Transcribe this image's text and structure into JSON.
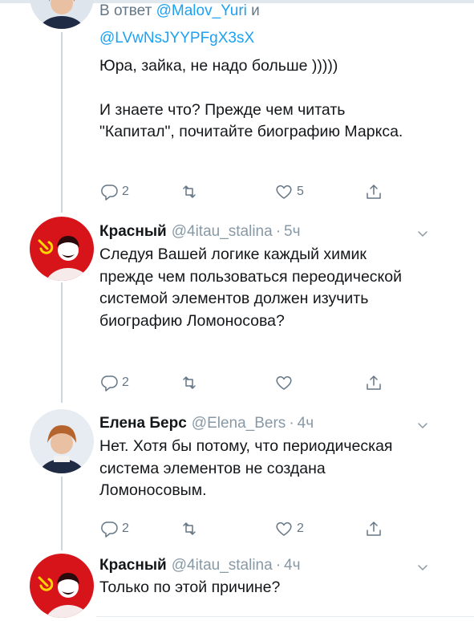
{
  "tweets": [
    {
      "reply_prefix": "В ответ",
      "reply_mention_1": "@Malov_Yuri",
      "reply_conjunction": "и",
      "reply_mention_2": "@LVwNsJYYPFgX3sX",
      "paragraph_1": "Юра, зайка, не надо больше )))))",
      "paragraph_2": "И знаете что? Прежде чем читать \"Капитал\", почитайте биографию Маркса.",
      "reply_count": "2",
      "retweet_count": "",
      "like_count": "5"
    },
    {
      "name": "Красный",
      "handle": "@4itau_stalina",
      "separator": "·",
      "time": "5ч",
      "text": "Следуя Вашей логике каждый химик прежде чем пользоваться переодической системой элементов должен изучить биографию Ломоносова?",
      "reply_count": "2",
      "retweet_count": "",
      "like_count": ""
    },
    {
      "name": "Елена Берс",
      "handle": "@Elena_Bers",
      "separator": "·",
      "time": "4ч",
      "text": "Нет. Хотя бы потому, что периодическая система элементов не создана Ломоносовым.",
      "reply_count": "2",
      "retweet_count": "",
      "like_count": "2"
    },
    {
      "name": "Красный",
      "handle": "@4itau_stalina",
      "separator": "·",
      "time": "4ч",
      "text": "Только по этой причине?"
    }
  ],
  "icons": {
    "reply": "reply-icon",
    "retweet": "retweet-icon",
    "like": "heart-icon",
    "share": "share-icon",
    "more": "chevron-down-icon"
  },
  "colors": {
    "text": "#14171a",
    "secondary": "#657786",
    "mention": "#1da1f2",
    "thread_line": "#ccd6dd",
    "soviet_red": "#d7141a"
  }
}
